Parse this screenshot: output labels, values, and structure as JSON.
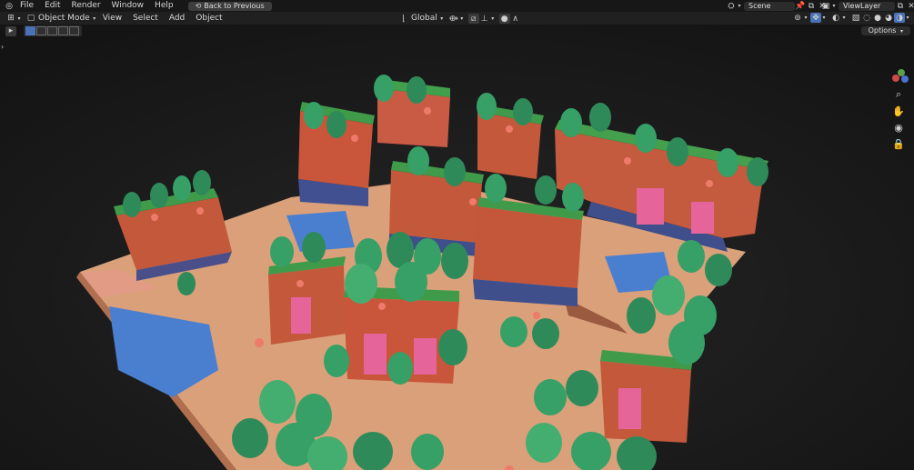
{
  "topbar": {
    "menus": [
      "File",
      "Edit",
      "Render",
      "Window",
      "Help"
    ],
    "back_button": "Back to Previous",
    "scene": "Scene",
    "view_layer": "ViewLayer"
  },
  "header": {
    "mode": "Object Mode",
    "menus": [
      "View",
      "Select",
      "Add",
      "Object"
    ],
    "transform_orientation": "Global"
  },
  "toolbar": {
    "options_label": "Options"
  },
  "colors": {
    "background": "#1a1a1a",
    "header": "#202020",
    "accent": "#4a72b8"
  }
}
